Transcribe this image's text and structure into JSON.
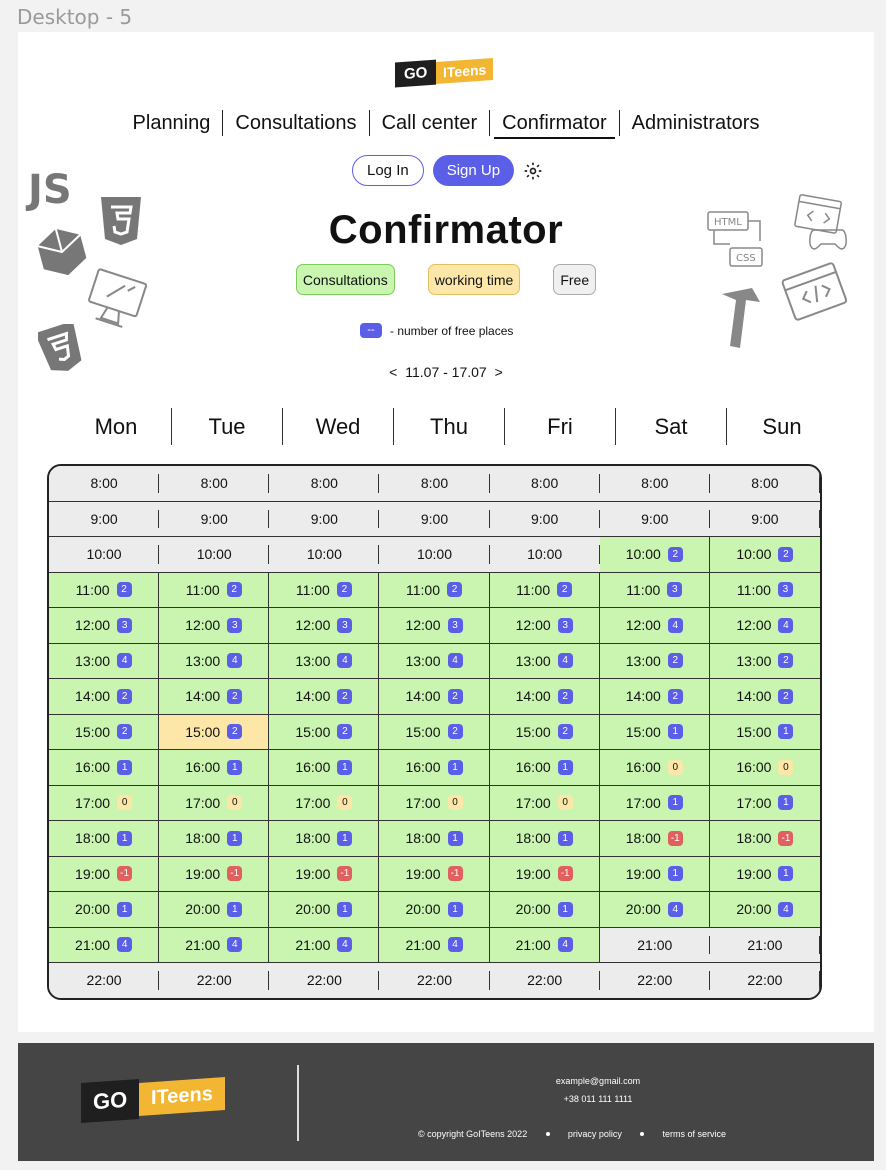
{
  "frame_label": "Desktop - 5",
  "logo": {
    "go": "GO",
    "iteens": "ITeens"
  },
  "nav": {
    "items": [
      {
        "label": "Planning"
      },
      {
        "label": "Consultations"
      },
      {
        "label": "Call center"
      },
      {
        "label": "Confirmator",
        "active": true
      },
      {
        "label": "Administrators"
      }
    ]
  },
  "auth": {
    "login_label": "Log In",
    "signup_label": "Sign Up"
  },
  "page_title": "Confirmator",
  "legend": {
    "consultations": "Consultations",
    "working_time": "working time",
    "free": "Free"
  },
  "places_note": {
    "badge": "--",
    "text": "- number of free places"
  },
  "week": {
    "prev": "<",
    "range": "11.07 - 17.07",
    "next": ">"
  },
  "days": [
    "Mon",
    "Tue",
    "Wed",
    "Thu",
    "Fri",
    "Sat",
    "Sun"
  ],
  "colors": {
    "accent": "#5b5fe8",
    "consultation_green": "#c9f5b0",
    "working_yellow": "#fde7a8",
    "free_gray": "#ececec",
    "negative_red": "#e06060"
  },
  "schedule": [
    [
      "8:00",
      "8:00",
      "8:00",
      "8:00",
      "8:00",
      "8:00",
      "8:00"
    ],
    [
      "9:00",
      "9:00",
      "9:00",
      "9:00",
      "9:00",
      "9:00",
      "9:00"
    ],
    [
      "10:00",
      "10:00",
      "10:00",
      "10:00",
      "10:00",
      "10:00|2",
      "10:00|2"
    ],
    [
      "11:00|2",
      "11:00|2",
      "11:00|2",
      "11:00|2",
      "11:00|2",
      "11:00|3",
      "11:00|3"
    ],
    [
      "12:00|3",
      "12:00|3",
      "12:00|3",
      "12:00|3",
      "12:00|3",
      "12:00|4",
      "12:00|4"
    ],
    [
      "13:00|4",
      "13:00|4",
      "13:00|4",
      "13:00|4",
      "13:00|4",
      "13:00|2",
      "13:00|2"
    ],
    [
      "14:00|2",
      "14:00|2",
      "14:00|2",
      "14:00|2",
      "14:00|2",
      "14:00|2",
      "14:00|2"
    ],
    [
      "15:00|2",
      "15:00|2",
      "15:00|2",
      "15:00|2",
      "15:00|2",
      "15:00|1",
      "15:00|1"
    ],
    [
      "16:00|1",
      "16:00|1",
      "16:00|1",
      "16:00|1",
      "16:00|1",
      "16:00|0",
      "16:00|0"
    ],
    [
      "17:00|0",
      "17:00|0",
      "17:00|0",
      "17:00|0",
      "17:00|0",
      "17:00|1",
      "17:00|1"
    ],
    [
      "18:00|1",
      "18:00|1",
      "18:00|1",
      "18:00|1",
      "18:00|1",
      "18:00|-1",
      "18:00|-1"
    ],
    [
      "19:00|-1",
      "19:00|-1",
      "19:00|-1",
      "19:00|-1",
      "19:00|-1",
      "19:00|1",
      "19:00|1"
    ],
    [
      "20:00|1",
      "20:00|1",
      "20:00|1",
      "20:00|1",
      "20:00|1",
      "20:00|4",
      "20:00|4"
    ],
    [
      "21:00|4",
      "21:00|4",
      "21:00|4",
      "21:00|4",
      "21:00|4",
      "21:00",
      "21:00"
    ],
    [
      "22:00",
      "22:00",
      "22:00",
      "22:00",
      "22:00",
      "22:00",
      "22:00"
    ]
  ],
  "highlight_working": [
    [
      7,
      1
    ]
  ],
  "footer": {
    "email": "example@gmail.com",
    "phone": "+38 011 111 1111",
    "copyright": "© copyright GoITeens 2022",
    "privacy": "privacy policy",
    "terms": "terms of service"
  },
  "icons": [
    "gear-icon",
    "js-icon",
    "html5-icon",
    "css3-icon",
    "cube-icon",
    "monitor-icon",
    "html-css-icon",
    "code-window-icon",
    "gamepad-icon",
    "cursor-icon"
  ]
}
